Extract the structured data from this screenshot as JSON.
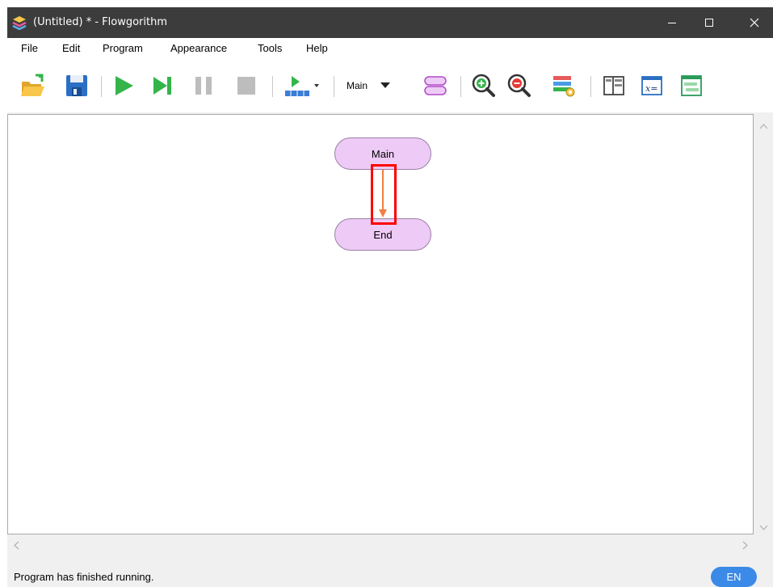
{
  "window": {
    "title": "(Untitled) * - Flowgorithm",
    "app_icon": "flowgorithm-logo-icon"
  },
  "menu": {
    "items": [
      {
        "label": "File"
      },
      {
        "label": "Edit"
      },
      {
        "label": "Program"
      },
      {
        "label": "Appearance"
      },
      {
        "label": "Tools"
      },
      {
        "label": "Help"
      }
    ]
  },
  "toolbar": {
    "icons": [
      "open-folder-icon",
      "save-icon",
      "run-icon",
      "step-icon",
      "pause-icon",
      "stop-icon",
      "run-speed-icon",
      "function-icon",
      "zoom-in-icon",
      "zoom-out-icon",
      "layout-icon",
      "code-window-icon",
      "variable-watch-icon",
      "console-icon"
    ],
    "function_selector": {
      "selected": "Main"
    }
  },
  "flowchart": {
    "start_label": "Main",
    "end_label": "End",
    "arrow_color": "#f08040",
    "shape_fill": "#eecbf6",
    "highlight_color": "#ff0000"
  },
  "status": {
    "message": "Program has finished running.",
    "language": "EN",
    "badge_color": "#3b8ae8"
  },
  "colors": {
    "titlebar": "#3c3c3c",
    "run_green": "#34b54a",
    "disabled_gray": "#bdbdbd"
  }
}
